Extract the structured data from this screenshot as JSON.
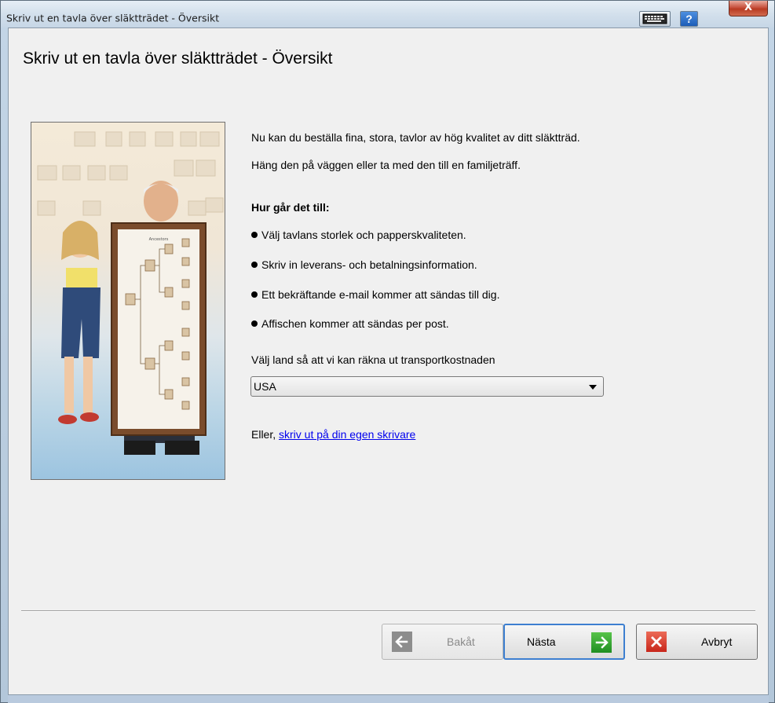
{
  "window": {
    "title": "Skriv ut en tavla över släktträdet - Översikt",
    "help_label": "?",
    "close_label": "X"
  },
  "page": {
    "heading": "Skriv ut en tavla över släktträdet - Översikt"
  },
  "intro": {
    "line1": "Nu kan du beställa fina, stora, tavlor av hög kvalitet av ditt släktträd.",
    "line2": "Häng den på väggen eller ta med den till en familjeträff."
  },
  "how": {
    "heading": "Hur går det till:",
    "steps": [
      "Välj tavlans storlek och papperskvaliteten.",
      "Skriv in leverans- och betalningsinformation.",
      "Ett bekräftande e-mail kommer att sändas till dig.",
      "Affischen kommer att sändas per post."
    ]
  },
  "country": {
    "label": "Välj land så att vi kan räkna ut transportkostnaden",
    "selected": "USA"
  },
  "alternative": {
    "prefix": "Eller, ",
    "link": "skriv ut på din egen skrivare"
  },
  "buttons": {
    "back": "Bakåt",
    "next": "Nästa",
    "cancel": "Avbryt"
  },
  "colors": {
    "accent": "#3d7fd0",
    "link": "#0000ee",
    "next_icon": "#1f8f22",
    "cancel_icon": "#c8261a"
  }
}
